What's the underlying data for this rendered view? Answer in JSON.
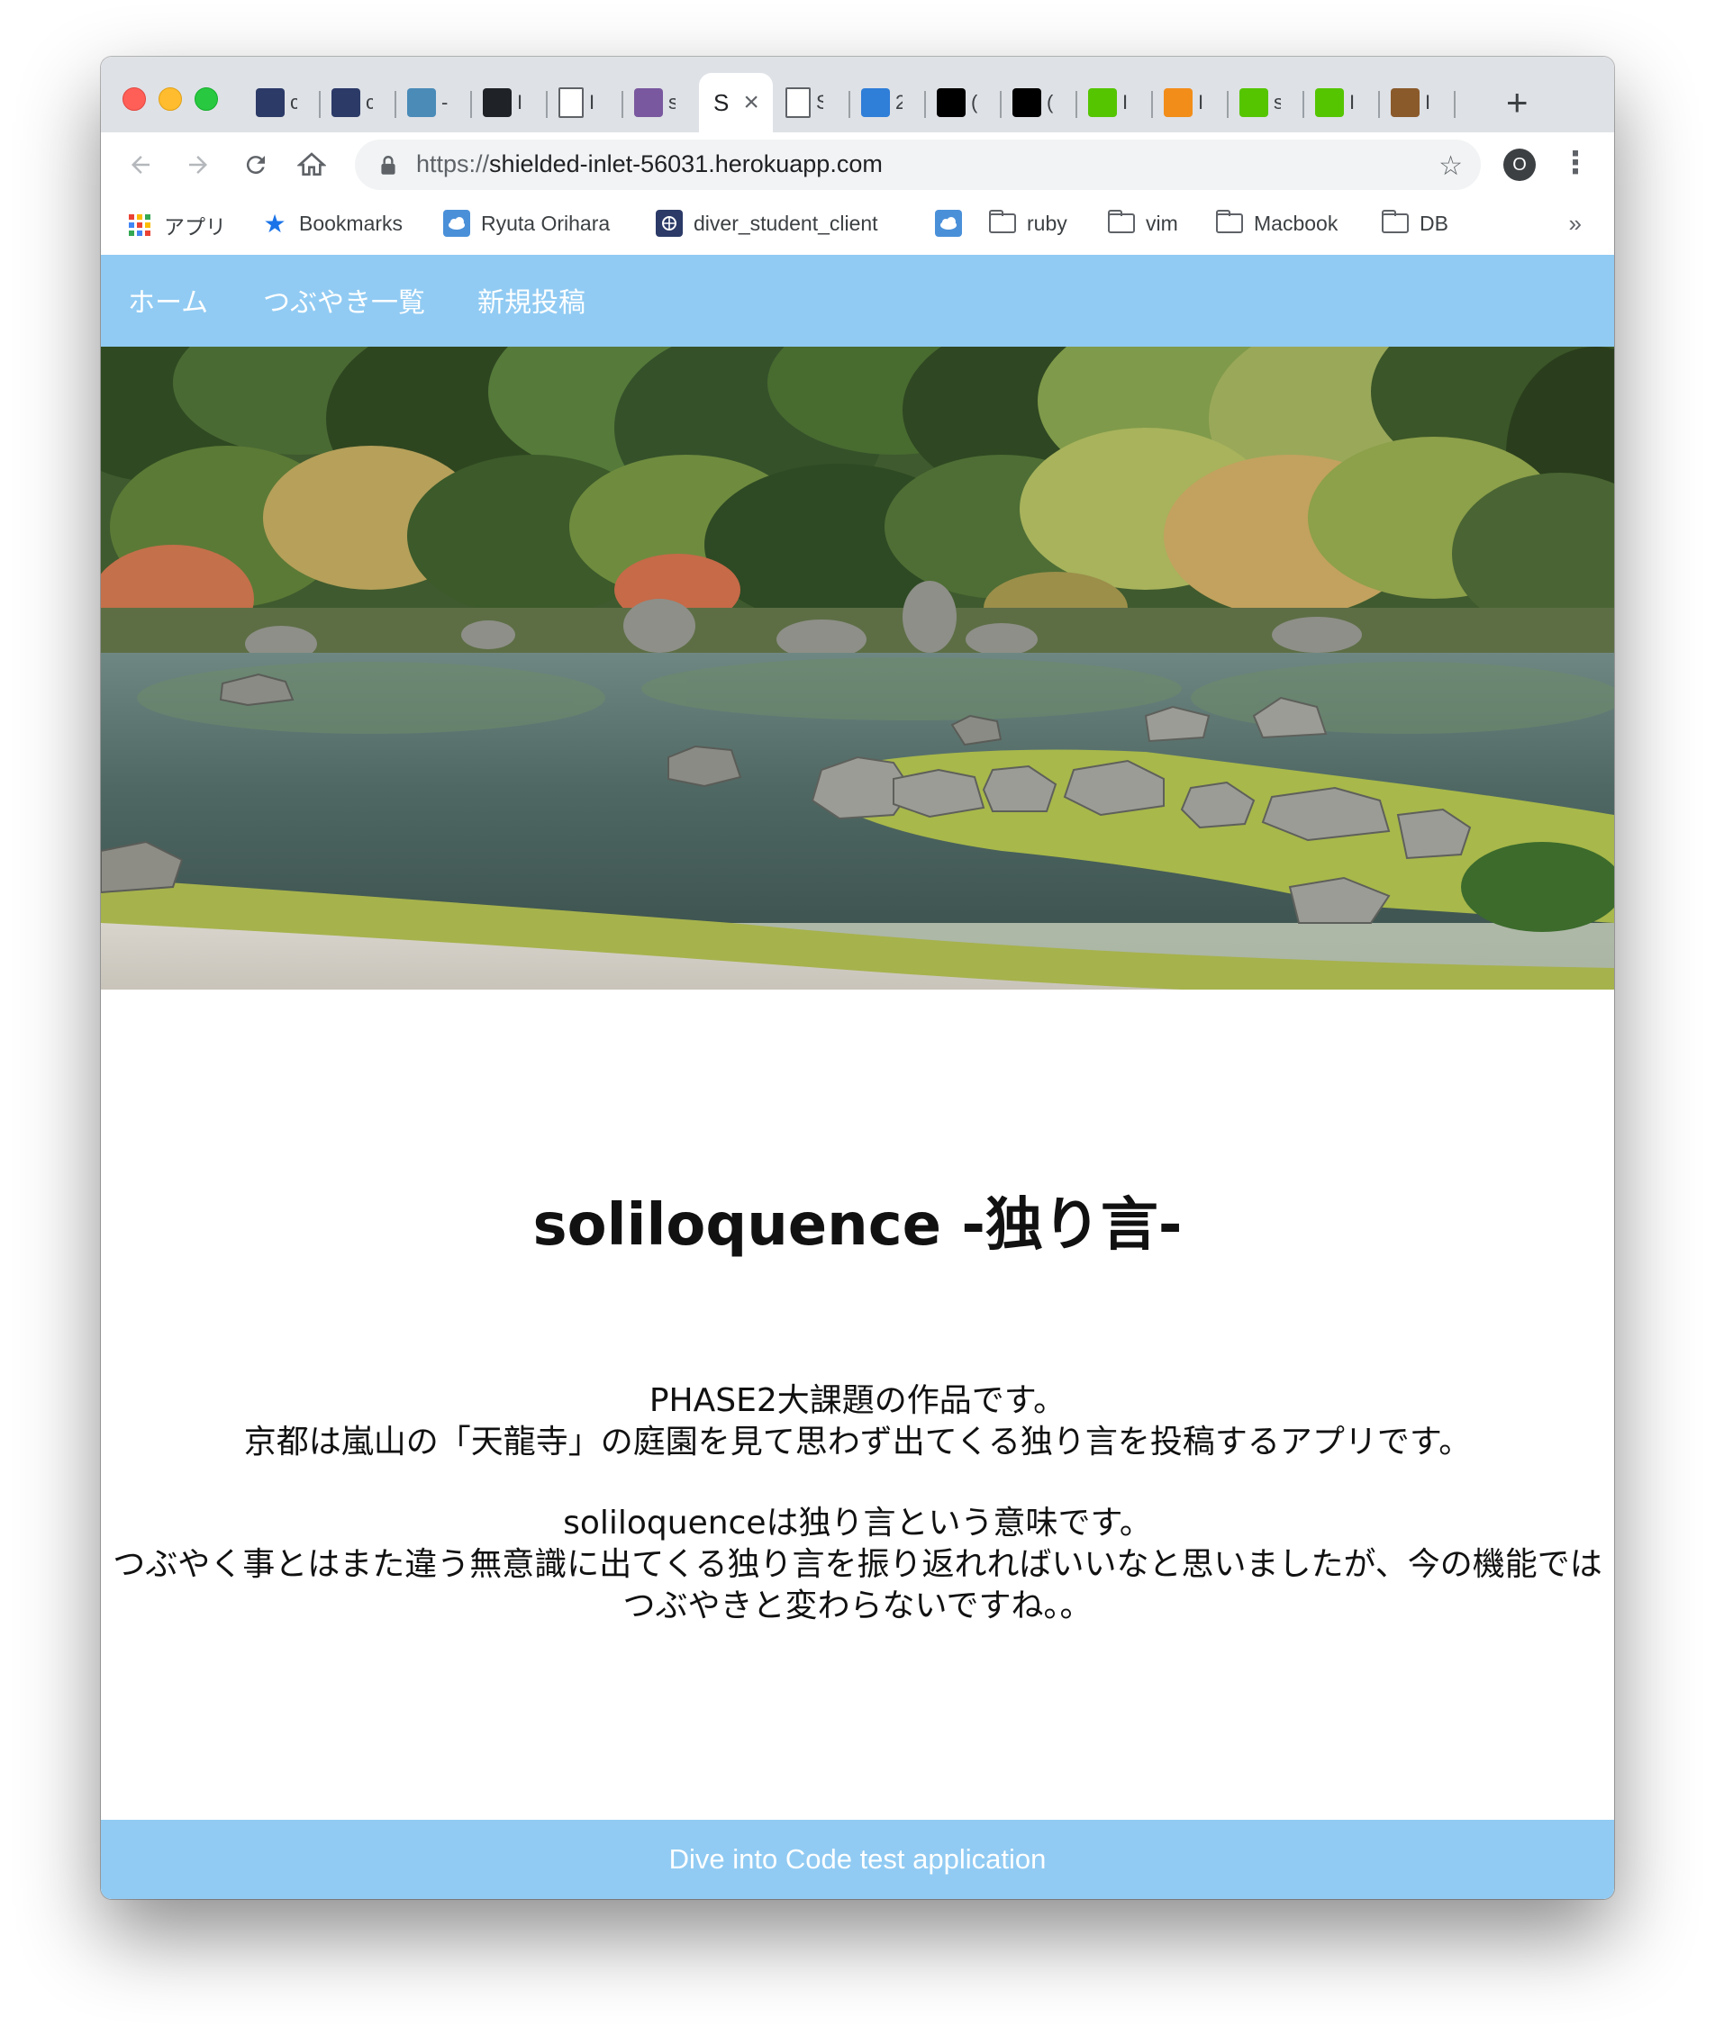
{
  "browser": {
    "tabs": [
      {
        "favicon": "globe-icon",
        "title": "c",
        "color": "#2b3a67"
      },
      {
        "favicon": "globe-icon",
        "title": "c",
        "color": "#2b3a67"
      },
      {
        "favicon": "cat-icon",
        "title": "-",
        "color": "#4a8bb8"
      },
      {
        "favicon": "github-icon",
        "title": "I",
        "color": "#1f2328"
      },
      {
        "favicon": "page-icon",
        "title": "I",
        "color": "#ffffff"
      },
      {
        "favicon": "heroku-icon",
        "title": "s",
        "color": "#79589f"
      },
      {
        "favicon": "text-icon",
        "title": "S",
        "color": "#ffffff",
        "active": true
      },
      {
        "favicon": "page-icon",
        "title": "S",
        "color": "#ffffff"
      },
      {
        "favicon": "colorful-icon",
        "title": "2",
        "color": "#2f7ed8"
      },
      {
        "favicon": "dark-icon",
        "title": "(",
        "color": "#000000"
      },
      {
        "favicon": "l-icon",
        "title": "(",
        "color": "#000000"
      },
      {
        "favicon": "qiita-icon",
        "title": "I",
        "color": "#55c500"
      },
      {
        "favicon": "hatena-icon",
        "title": "I",
        "color": "#f28d1a"
      },
      {
        "favicon": "qiita-icon",
        "title": "s",
        "color": "#55c500"
      },
      {
        "favicon": "qiita-icon",
        "title": "I",
        "color": "#55c500"
      },
      {
        "favicon": "v-icon",
        "title": "I",
        "color": "#8b5a2b"
      }
    ],
    "url_scheme": "https://",
    "url_host": "shielded-inlet-56031.herokuapp.com",
    "profile_initial": "O",
    "bookmarks": [
      {
        "label": "アプリ",
        "icon": "apps-icon"
      },
      {
        "label": "Bookmarks",
        "icon": "star-icon"
      },
      {
        "label": "Ryuta Orihara",
        "icon": "cloud-icon"
      },
      {
        "label": "diver_student_client",
        "icon": "globe-icon"
      },
      {
        "label": "",
        "icon": "cloud-icon"
      },
      {
        "label": "ruby",
        "icon": "folder-icon"
      },
      {
        "label": "vim",
        "icon": "folder-icon"
      },
      {
        "label": "Macbook",
        "icon": "folder-icon"
      },
      {
        "label": "DB",
        "icon": "folder-icon"
      }
    ],
    "overflow": "»"
  },
  "site": {
    "nav": {
      "home": "ホーム",
      "list": "つぶやき一覧",
      "new_post": "新規投稿"
    },
    "title": "soliloquence -独り言-",
    "desc_line1": "PHASE2大課題の作品です。",
    "desc_line2": "京都は嵐山の「天龍寺」の庭園を見て思わず出てくる独り言を投稿するアプリです。",
    "desc_line3": "soliloquenceは独り言という意味です。",
    "desc_line4": "つぶやく事とはまた違う無意識に出てくる独り言を振り返れればいいなと思いましたが、今の機能ではつぶやきと変わらないですね。。",
    "footer": "Dive into Code test application"
  },
  "colors": {
    "nav_bg": "#91cbf3",
    "footer_bg": "#91cbf3"
  }
}
